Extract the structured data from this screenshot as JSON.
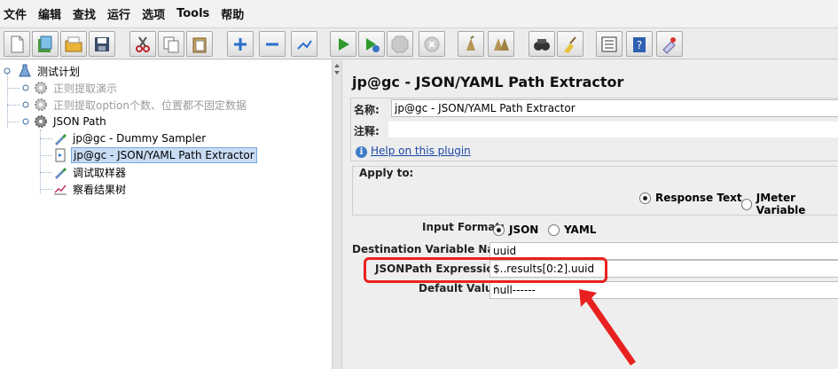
{
  "menu": [
    "文件",
    "编辑",
    "查找",
    "运行",
    "选项",
    "Tools",
    "帮助"
  ],
  "toolbar": [
    "new-icon",
    "templates-icon",
    "open-icon",
    "save-icon",
    "cut-icon",
    "copy-icon",
    "paste-icon",
    "expand-icon",
    "collapse-icon",
    "toggle-icon",
    "start-icon",
    "start-no-pause-icon",
    "stop-icon",
    "shutdown-icon",
    "clear-icon",
    "clear-all-icon",
    "search-icon",
    "reset-search-icon",
    "function-helper-icon",
    "help-icon",
    "remote-icon"
  ],
  "tree": {
    "root": "测试计划",
    "items": [
      {
        "label": "正则提取演示",
        "disabled": true
      },
      {
        "label": "正则提取option个数、位置都不固定数据",
        "disabled": true
      },
      {
        "label": "JSON Path",
        "disabled": false
      },
      {
        "label": "jp@gc - Dummy Sampler"
      },
      {
        "label": "jp@gc - JSON/YAML Path Extractor",
        "selected": true
      },
      {
        "label": "调试取样器"
      },
      {
        "label": "察看结果树"
      }
    ]
  },
  "editor": {
    "title": "jp@gc - JSON/YAML Path Extractor",
    "name_label": "名称:",
    "name_value": "jp@gc - JSON/YAML Path Extractor",
    "comment_label": "注释:",
    "comment_value": "",
    "help_link": "Help on this plugin",
    "apply_to_label": "Apply to:",
    "apply_options": [
      "Response Text",
      "JMeter Variable"
    ],
    "apply_selected": "Response Text",
    "input_format_label": "Input Format:",
    "input_format_options": [
      "JSON",
      "YAML"
    ],
    "input_format_selected": "JSON",
    "dest_var_label": "Destination Variable Name:",
    "dest_var_value": "uuid",
    "jsonpath_label": "JSONPath Expression:",
    "jsonpath_value": "$..results[0:2].uuid",
    "default_label": "Default Value:",
    "default_value": "null------"
  },
  "colors": {
    "highlight": "#e8211f",
    "selection": "#c8dcf4",
    "link": "#1b47a6"
  }
}
